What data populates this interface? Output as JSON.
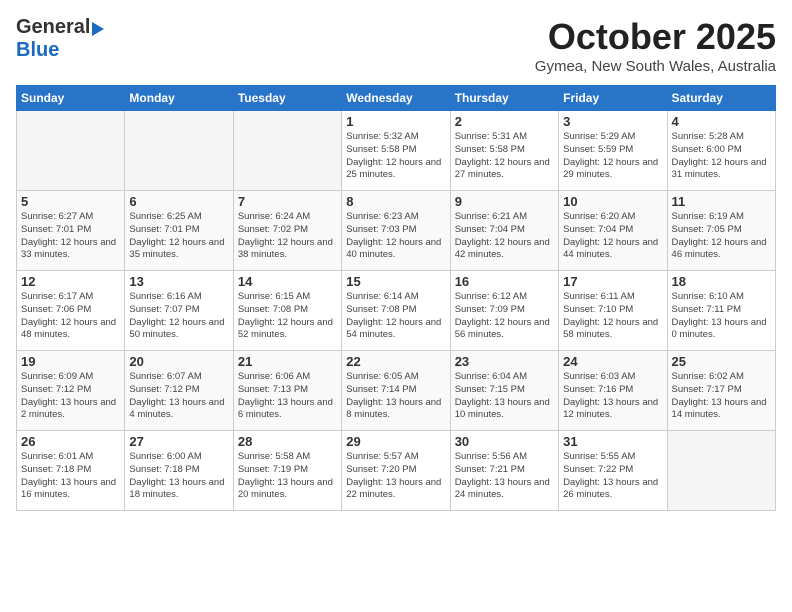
{
  "header": {
    "logo_general": "General",
    "logo_blue": "Blue",
    "month": "October 2025",
    "location": "Gymea, New South Wales, Australia"
  },
  "weekdays": [
    "Sunday",
    "Monday",
    "Tuesday",
    "Wednesday",
    "Thursday",
    "Friday",
    "Saturday"
  ],
  "weeks": [
    [
      {
        "day": "",
        "empty": true
      },
      {
        "day": "",
        "empty": true
      },
      {
        "day": "",
        "empty": true
      },
      {
        "day": "1",
        "sunrise": "5:32 AM",
        "sunset": "5:58 PM",
        "daylight": "12 hours and 25 minutes."
      },
      {
        "day": "2",
        "sunrise": "5:31 AM",
        "sunset": "5:58 PM",
        "daylight": "12 hours and 27 minutes."
      },
      {
        "day": "3",
        "sunrise": "5:29 AM",
        "sunset": "5:59 PM",
        "daylight": "12 hours and 29 minutes."
      },
      {
        "day": "4",
        "sunrise": "5:28 AM",
        "sunset": "6:00 PM",
        "daylight": "12 hours and 31 minutes."
      }
    ],
    [
      {
        "day": "5",
        "sunrise": "6:27 AM",
        "sunset": "7:01 PM",
        "daylight": "12 hours and 33 minutes."
      },
      {
        "day": "6",
        "sunrise": "6:25 AM",
        "sunset": "7:01 PM",
        "daylight": "12 hours and 35 minutes."
      },
      {
        "day": "7",
        "sunrise": "6:24 AM",
        "sunset": "7:02 PM",
        "daylight": "12 hours and 38 minutes."
      },
      {
        "day": "8",
        "sunrise": "6:23 AM",
        "sunset": "7:03 PM",
        "daylight": "12 hours and 40 minutes."
      },
      {
        "day": "9",
        "sunrise": "6:21 AM",
        "sunset": "7:04 PM",
        "daylight": "12 hours and 42 minutes."
      },
      {
        "day": "10",
        "sunrise": "6:20 AM",
        "sunset": "7:04 PM",
        "daylight": "12 hours and 44 minutes."
      },
      {
        "day": "11",
        "sunrise": "6:19 AM",
        "sunset": "7:05 PM",
        "daylight": "12 hours and 46 minutes."
      }
    ],
    [
      {
        "day": "12",
        "sunrise": "6:17 AM",
        "sunset": "7:06 PM",
        "daylight": "12 hours and 48 minutes."
      },
      {
        "day": "13",
        "sunrise": "6:16 AM",
        "sunset": "7:07 PM",
        "daylight": "12 hours and 50 minutes."
      },
      {
        "day": "14",
        "sunrise": "6:15 AM",
        "sunset": "7:08 PM",
        "daylight": "12 hours and 52 minutes."
      },
      {
        "day": "15",
        "sunrise": "6:14 AM",
        "sunset": "7:08 PM",
        "daylight": "12 hours and 54 minutes."
      },
      {
        "day": "16",
        "sunrise": "6:12 AM",
        "sunset": "7:09 PM",
        "daylight": "12 hours and 56 minutes."
      },
      {
        "day": "17",
        "sunrise": "6:11 AM",
        "sunset": "7:10 PM",
        "daylight": "12 hours and 58 minutes."
      },
      {
        "day": "18",
        "sunrise": "6:10 AM",
        "sunset": "7:11 PM",
        "daylight": "13 hours and 0 minutes."
      }
    ],
    [
      {
        "day": "19",
        "sunrise": "6:09 AM",
        "sunset": "7:12 PM",
        "daylight": "13 hours and 2 minutes."
      },
      {
        "day": "20",
        "sunrise": "6:07 AM",
        "sunset": "7:12 PM",
        "daylight": "13 hours and 4 minutes."
      },
      {
        "day": "21",
        "sunrise": "6:06 AM",
        "sunset": "7:13 PM",
        "daylight": "13 hours and 6 minutes."
      },
      {
        "day": "22",
        "sunrise": "6:05 AM",
        "sunset": "7:14 PM",
        "daylight": "13 hours and 8 minutes."
      },
      {
        "day": "23",
        "sunrise": "6:04 AM",
        "sunset": "7:15 PM",
        "daylight": "13 hours and 10 minutes."
      },
      {
        "day": "24",
        "sunrise": "6:03 AM",
        "sunset": "7:16 PM",
        "daylight": "13 hours and 12 minutes."
      },
      {
        "day": "25",
        "sunrise": "6:02 AM",
        "sunset": "7:17 PM",
        "daylight": "13 hours and 14 minutes."
      }
    ],
    [
      {
        "day": "26",
        "sunrise": "6:01 AM",
        "sunset": "7:18 PM",
        "daylight": "13 hours and 16 minutes."
      },
      {
        "day": "27",
        "sunrise": "6:00 AM",
        "sunset": "7:18 PM",
        "daylight": "13 hours and 18 minutes."
      },
      {
        "day": "28",
        "sunrise": "5:58 AM",
        "sunset": "7:19 PM",
        "daylight": "13 hours and 20 minutes."
      },
      {
        "day": "29",
        "sunrise": "5:57 AM",
        "sunset": "7:20 PM",
        "daylight": "13 hours and 22 minutes."
      },
      {
        "day": "30",
        "sunrise": "5:56 AM",
        "sunset": "7:21 PM",
        "daylight": "13 hours and 24 minutes."
      },
      {
        "day": "31",
        "sunrise": "5:55 AM",
        "sunset": "7:22 PM",
        "daylight": "13 hours and 26 minutes."
      },
      {
        "day": "",
        "empty": true
      }
    ]
  ]
}
